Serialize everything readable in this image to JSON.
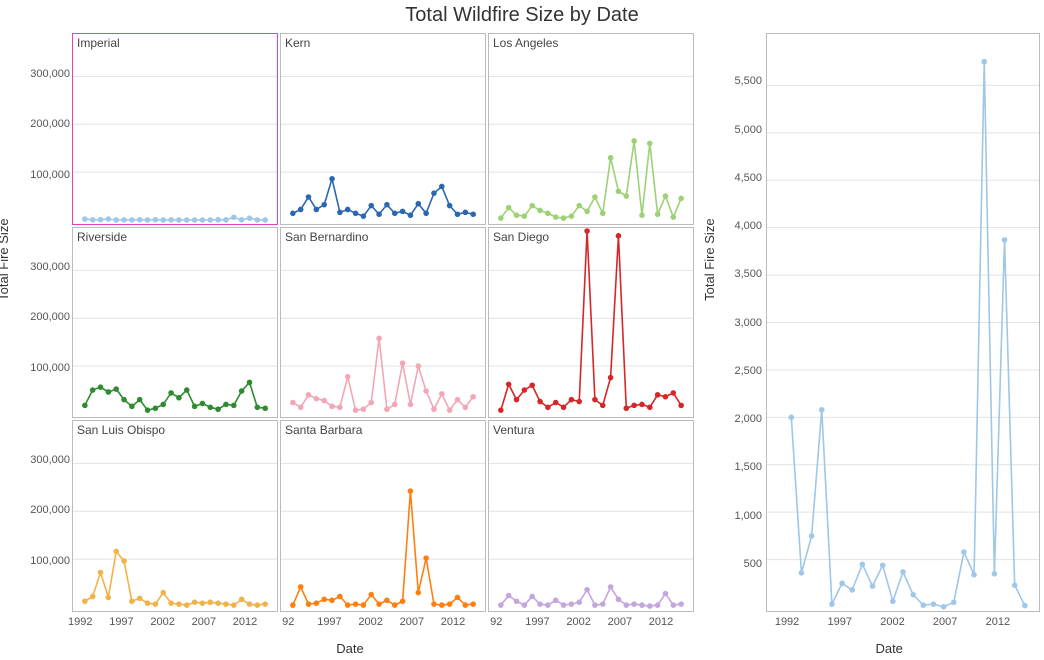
{
  "title": "Total Wildfire Size by Date",
  "left": {
    "ylabel": "Total Fire Size",
    "xlabel": "Date",
    "yticks": [
      "100,000",
      "200,000",
      "300,000"
    ],
    "yticks_vals": [
      100000,
      200000,
      300000
    ],
    "xticks_first": [
      "1992",
      "1997",
      "2002",
      "2007",
      "2012"
    ],
    "xticks_other": [
      "92",
      "1997",
      "2002",
      "2007",
      "2012"
    ]
  },
  "right": {
    "ylabel": "Total Fire Size",
    "xlabel": "Date",
    "yticks": [
      "500",
      "1,000",
      "1,500",
      "2,000",
      "2,500",
      "3,000",
      "3,500",
      "4,000",
      "4,500",
      "5,000",
      "5,500"
    ],
    "yticks_vals": [
      500,
      1000,
      1500,
      2000,
      2500,
      3000,
      3500,
      4000,
      4500,
      5000,
      5500
    ],
    "xticks": [
      "1992",
      "1997",
      "2002",
      "2007",
      "2012"
    ]
  },
  "chart_data": {
    "title": "Total Wildfire Size by Date",
    "layout": "small-multiples-with-detail",
    "small_multiples": {
      "type": "line",
      "xlabel": "Date",
      "ylabel": "Total Fire Size",
      "x": [
        1992,
        1993,
        1994,
        1995,
        1996,
        1997,
        1998,
        1999,
        2000,
        2001,
        2002,
        2003,
        2004,
        2005,
        2006,
        2007,
        2008,
        2009,
        2010,
        2011,
        2012,
        2013,
        2014,
        2015
      ],
      "xlim": [
        1991,
        2016
      ],
      "ylim": [
        0,
        380000
      ],
      "grid": {
        "x": false,
        "y": true
      },
      "panels": [
        {
          "name": "Imperial",
          "color": "#9ec7e8",
          "selected": true,
          "values": [
            2000,
            360,
            750,
            2080,
            30,
            250,
            180,
            450,
            220,
            440,
            60,
            370,
            130,
            20,
            30,
            2,
            50,
            580,
            340,
            5750,
            350,
            3870,
            230,
            15
          ]
        },
        {
          "name": "Kern",
          "color": "#2a67b3",
          "values": [
            14000,
            22000,
            48000,
            22000,
            32000,
            86000,
            16000,
            22000,
            14000,
            8000,
            30000,
            12000,
            32000,
            14000,
            18000,
            10000,
            34000,
            14000,
            56000,
            70000,
            30000,
            12000,
            16000,
            12000
          ]
        },
        {
          "name": "Los Angeles",
          "color": "#9ed175",
          "values": [
            4000,
            26000,
            10000,
            8000,
            30000,
            20000,
            14000,
            6000,
            4000,
            8000,
            30000,
            18000,
            48000,
            14000,
            130000,
            60000,
            50000,
            165000,
            10000,
            160000,
            12000,
            50000,
            6000,
            45000
          ]
        },
        {
          "name": "Riverside",
          "color": "#2e8b2e",
          "values": [
            18000,
            50000,
            56000,
            46000,
            52000,
            30000,
            16000,
            30000,
            8000,
            12000,
            20000,
            44000,
            34000,
            50000,
            16000,
            22000,
            14000,
            10000,
            20000,
            18000,
            48000,
            66000,
            14000,
            12000
          ]
        },
        {
          "name": "San Bernardino",
          "color": "#f2a6b6",
          "values": [
            24000,
            14000,
            40000,
            32000,
            28000,
            16000,
            14000,
            78000,
            8000,
            10000,
            24000,
            158000,
            10000,
            20000,
            106000,
            20000,
            100000,
            48000,
            10000,
            42000,
            8000,
            30000,
            14000,
            36000
          ]
        },
        {
          "name": "San Diego",
          "color": "#d62728",
          "values": [
            8000,
            62000,
            30000,
            50000,
            60000,
            26000,
            14000,
            24000,
            14000,
            30000,
            26000,
            382000,
            30000,
            18000,
            76000,
            372000,
            12000,
            18000,
            20000,
            14000,
            40000,
            36000,
            44000,
            18000
          ]
        },
        {
          "name": "San Luis Obispo",
          "color": "#f2b24a",
          "values": [
            12000,
            22000,
            72000,
            20000,
            116000,
            96000,
            12000,
            18000,
            8000,
            6000,
            30000,
            8000,
            6000,
            4000,
            10000,
            8000,
            10000,
            8000,
            6000,
            4000,
            16000,
            6000,
            4000,
            6000
          ]
        },
        {
          "name": "Santa Barbara",
          "color": "#ff7f0e",
          "values": [
            4000,
            42000,
            6000,
            8000,
            16000,
            14000,
            22000,
            4000,
            6000,
            4000,
            26000,
            6000,
            14000,
            4000,
            12000,
            242000,
            30000,
            102000,
            6000,
            4000,
            6000,
            20000,
            4000,
            6000
          ]
        },
        {
          "name": "Ventura",
          "color": "#c3a6dc",
          "values": [
            4000,
            24000,
            12000,
            4000,
            22000,
            6000,
            4000,
            14000,
            4000,
            6000,
            10000,
            36000,
            4000,
            6000,
            42000,
            16000,
            4000,
            6000,
            4000,
            2000,
            4000,
            28000,
            4000,
            6000
          ]
        }
      ]
    },
    "detail": {
      "type": "line",
      "title": "Imperial",
      "color": "#9ec7e8",
      "xlabel": "Date",
      "ylabel": "Total Fire Size",
      "xlim": [
        1990,
        2016
      ],
      "ylim": [
        0,
        6000
      ],
      "grid": {
        "x": false,
        "y": true
      },
      "x": [
        1992,
        1993,
        1994,
        1995,
        1996,
        1997,
        1998,
        1999,
        2000,
        2001,
        2002,
        2003,
        2004,
        2005,
        2006,
        2007,
        2008,
        2009,
        2010,
        2011,
        2012,
        2013,
        2014,
        2015
      ],
      "values": [
        2000,
        360,
        750,
        2080,
        30,
        250,
        180,
        450,
        220,
        440,
        60,
        370,
        130,
        20,
        30,
        2,
        50,
        580,
        340,
        5750,
        350,
        3870,
        230,
        15
      ],
      "markers": true
    }
  }
}
